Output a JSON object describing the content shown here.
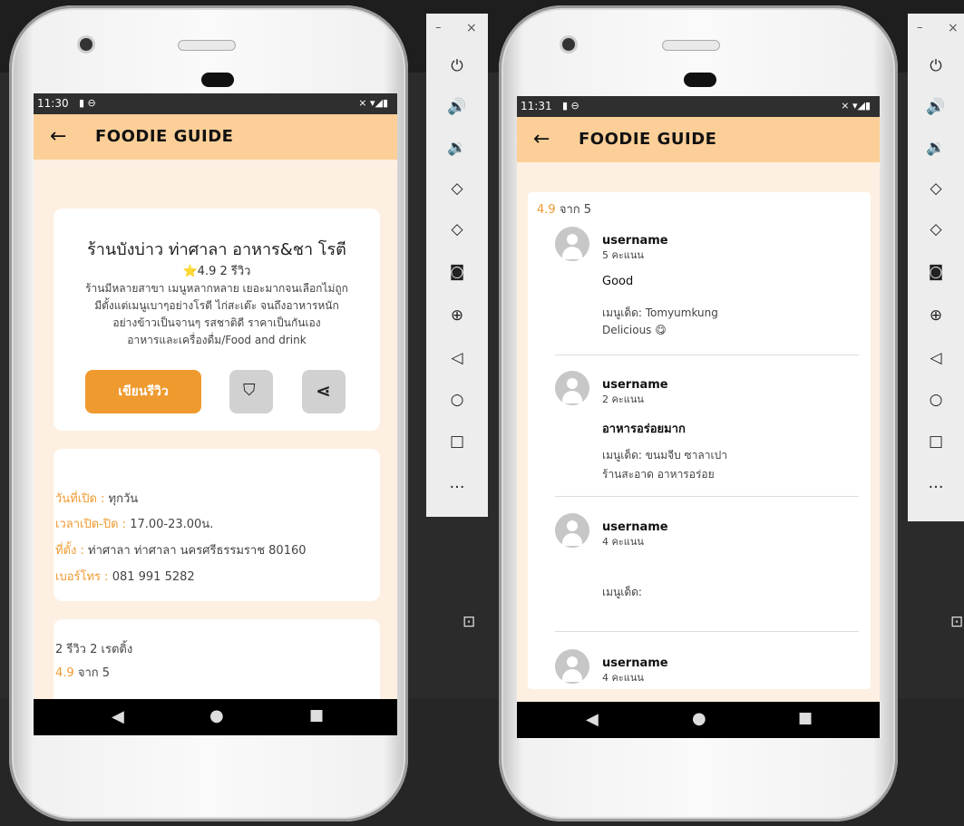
{
  "left_phone": {
    "status": {
      "time": "11:30",
      "left_icons": "▮ ⊖",
      "right_icons": "⨯ ▾◢▮"
    },
    "app_title": "FOODIE GUIDE",
    "restaurant": {
      "name": "ร้านบังบ่าว ท่าศาลา อาหาร&ชา โรตี",
      "rating_line": "⭐4.9 2 รีวิว",
      "desc_lines": [
        "ร้านมีหลายสาขา เมนูหลากหลาย เยอะมากจนเลือกไม่ถูก",
        "มีตั้งแต่เมนูเบาๆอย่างโรตี ไก่สะเต๊ะ จนถึงอาหารหนัก",
        "อย่างข้าวเป็นจานๆ รสชาติดี ราคาเป็นกันเอง",
        "อาหารและเครื่องดื่ม/Food and drink"
      ],
      "review_button": "เขียนรีวิว"
    },
    "info": {
      "open_days_label": "วันที่เปิด :",
      "open_days_value": "ทุกวัน",
      "hours_label": "เวลาเปิด-ปิด :",
      "hours_value": "17.00-23.00น.",
      "address_label": "ที่ตั้ง :",
      "address_value": "ท่าศาลา ท่าศาลา นครศรีธรรมราช 80160",
      "phone_label": "เบอร์โทร :",
      "phone_value": "081 991 5282"
    },
    "summary": {
      "counts": "2 รีวิว 2 เรตติ้ง",
      "score": "4.9",
      "of": "จาก 5"
    }
  },
  "right_phone": {
    "status": {
      "time": "11:31",
      "left_icons": "▮ ⊖",
      "right_icons": "⨯ ▾◢▮"
    },
    "app_title": "FOODIE GUIDE",
    "summary": {
      "score": "4.9",
      "of": "จาก 5"
    },
    "reviews": [
      {
        "username": "username",
        "points": "5 คะแนน",
        "title": "Good",
        "menu": "เมนูเด็ด: Tomyumkung",
        "comment": "Delicious 😋"
      },
      {
        "username": "username",
        "points": "2 คะแนน",
        "title": "อาหารอร่อยมาก",
        "menu": "เมนูเด็ด: ขนมจีบ ซาลาเปา",
        "comment": "ร้านสะอาด อาหารอร่อย"
      },
      {
        "username": "username",
        "points": "4 คะแนน",
        "title": "",
        "menu": "เมนูเด็ด:",
        "comment": ""
      },
      {
        "username": "username",
        "points": "4 คะแนน",
        "title": "",
        "menu": "",
        "comment": ""
      }
    ]
  },
  "emulator_panel": {
    "window_controls": {
      "minimize": "–",
      "close": "×"
    },
    "icons": [
      "power-icon",
      "volume-up-icon",
      "volume-down-icon",
      "rotate-left-icon",
      "rotate-right-icon",
      "camera-icon",
      "zoom-icon",
      "back-icon",
      "home-icon",
      "overview-icon",
      "more-icon"
    ],
    "glyphs": {
      "power": "⏻",
      "volume_up": "🔊",
      "volume_down": "🔉",
      "rotate_left": "◇",
      "rotate_right": "◇",
      "camera": "◙",
      "zoom": "⊕",
      "back": "◁",
      "home": "○",
      "overview": "□",
      "more": "…",
      "expand": "⊡"
    }
  },
  "nav_glyphs": {
    "back": "◀",
    "home": "●",
    "recent": "■",
    "arrow": "←",
    "bookmark": "⛉",
    "share": "⋖"
  },
  "colors": {
    "accent": "#ef9a2f",
    "appbar": "#fdcf98",
    "screen_bg": "#fdf0e2"
  }
}
